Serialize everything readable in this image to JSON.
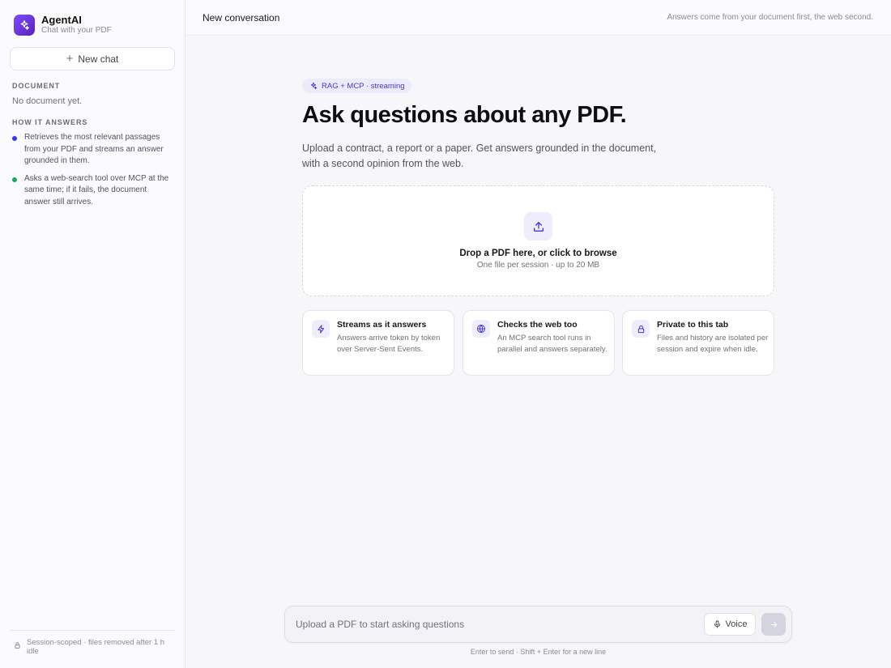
{
  "sidebar": {
    "brand_name": "AgentAI",
    "brand_sub": "Chat with your PDF",
    "new_chat_label": "New chat",
    "document_heading": "DOCUMENT",
    "no_document_text": "No document yet.",
    "how_heading": "HOW IT ANSWERS",
    "how_items": [
      {
        "text": "Retrieves the most relevant passages from your PDF and streams an answer grounded in them.",
        "dot_color": "#3b3ad6"
      },
      {
        "text": "Asks a web-search tool over MCP at the same time; if it fails, the document answer still arrives.",
        "dot_color": "#17a868"
      }
    ],
    "footer_text": "Session-scoped · files removed after 1 h idle"
  },
  "topbar": {
    "title": "New conversation",
    "note": "Answers come from your document first, the web second."
  },
  "hero": {
    "tag": "RAG + MCP · streaming",
    "title": "Ask questions about any PDF.",
    "description": "Upload a contract, a report or a paper. Get answers grounded in the document, with a second opinion from the web."
  },
  "dropzone": {
    "title": "Drop a PDF here, or click to browse",
    "subtitle": "One file per session · up to 20 MB"
  },
  "features": [
    {
      "icon": "lightning-icon",
      "title": "Streams as it answers",
      "desc": "Answers arrive token by token over Server-Sent Events."
    },
    {
      "icon": "globe-icon",
      "title": "Checks the web too",
      "desc": "An MCP search tool runs in parallel and answers separately."
    },
    {
      "icon": "lock-icon",
      "title": "Private to this tab",
      "desc": "Files and history are isolated per session and expire when idle."
    }
  ],
  "composer": {
    "placeholder": "Upload a PDF to start asking questions",
    "value": "",
    "voice_label": "Voice",
    "hint": "Enter to send · Shift + Enter for a new line"
  },
  "colors": {
    "accent": "#4f46e5",
    "brand_gradient_start": "#7c4dff",
    "brand_gradient_end": "#5b21b6"
  }
}
